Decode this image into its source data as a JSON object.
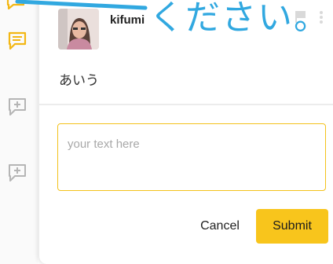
{
  "overlay": {
    "text": "ください。"
  },
  "comment": {
    "username": "kifumi",
    "timestamp": "",
    "text": "あいう"
  },
  "reply": {
    "placeholder": "your text here"
  },
  "actions": {
    "cancel_label": "Cancel",
    "submit_label": "Submit"
  },
  "icons": {
    "left_rail": [
      "comment-active-icon",
      "comment-active-icon",
      "add-comment-icon",
      "add-comment-icon"
    ],
    "header": [
      "flag-icon",
      "more-icon"
    ]
  },
  "colors": {
    "accent_yellow": "#f8c51c",
    "reply_border": "#f3c21b",
    "overlay_blue": "#31a8e0",
    "rail_icon_grey": "#b5b5b5"
  }
}
